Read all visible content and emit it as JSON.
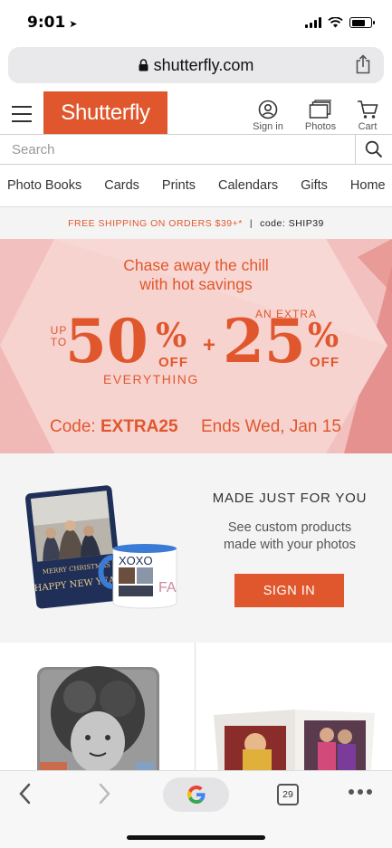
{
  "status_bar": {
    "time": "9:01"
  },
  "browser": {
    "url": "shutterfly.com",
    "tab_count": "29"
  },
  "header": {
    "logo": "Shutterfly",
    "signin_label": "Sign in",
    "photos_label": "Photos",
    "cart_label": "Cart"
  },
  "search": {
    "placeholder": "Search"
  },
  "nav": {
    "items": [
      "Photo Books",
      "Cards",
      "Prints",
      "Calendars",
      "Gifts",
      "Home"
    ]
  },
  "promo_strip": {
    "offer": "FREE SHIPPING ON ORDERS $39+*",
    "code": "code: SHIP39"
  },
  "hero": {
    "headline_line1": "Chase away the chill",
    "headline_line2": "with hot savings",
    "up_to": "UP TO",
    "discount1": "50",
    "percent": "%",
    "off": "OFF",
    "everything": "EVERYTHING",
    "plus": "+",
    "an_extra": "AN EXTRA",
    "discount2": "25",
    "code_label": "Code:",
    "code": "EXTRA25",
    "ends": "Ends Wed, Jan 15"
  },
  "made_for_you": {
    "title": "MADE JUST FOR YOU",
    "text_line1": "See custom products",
    "text_line2": "made with your photos",
    "button": "SIGN IN",
    "card_text1": "MERRY CHRISTMAS",
    "card_text2": "HAPPY NEW YEAR",
    "mug_text": "XOXO",
    "mug_side": "FA"
  },
  "colors": {
    "brand": "#e0572d",
    "hero_bg": "#f2c1bf"
  }
}
